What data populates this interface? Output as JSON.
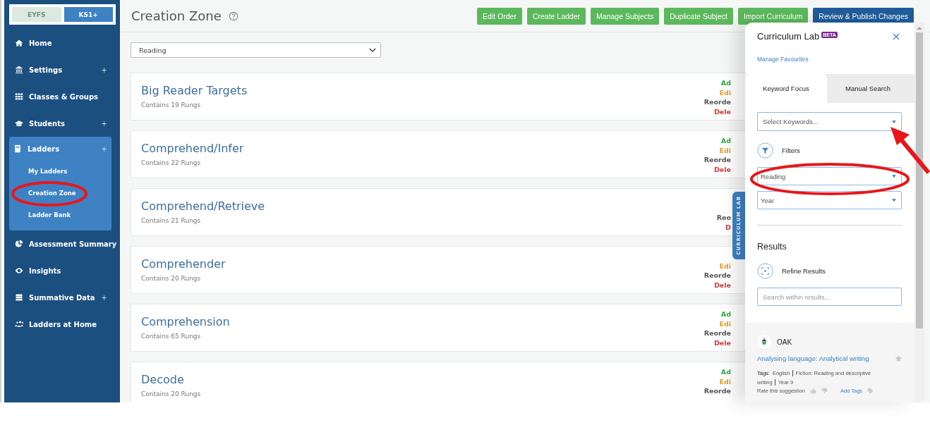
{
  "sidebar": {
    "level_toggle": [
      {
        "label": "EYFS",
        "selected": false
      },
      {
        "label": "KS1+",
        "selected": true
      }
    ],
    "items": [
      {
        "label": "Home",
        "expanded": false
      },
      {
        "label": "Settings",
        "toggle": "+",
        "expanded": false
      },
      {
        "label": "Classes & Groups",
        "expanded": false
      },
      {
        "label": "Students",
        "toggle": "+",
        "expanded": false
      },
      {
        "label": "Ladders",
        "toggle": "+",
        "expanded": true,
        "children": [
          {
            "label": "My Ladders"
          },
          {
            "label": "Creation Zone"
          },
          {
            "label": "Ladder Bank"
          }
        ]
      },
      {
        "label": "Assessment Summary",
        "expanded": false
      },
      {
        "label": "Insights",
        "expanded": false
      },
      {
        "label": "Summative Data",
        "toggle": "+",
        "expanded": false
      },
      {
        "label": "Ladders at Home",
        "expanded": false
      }
    ]
  },
  "header": {
    "title": "Creation Zone",
    "buttons": [
      {
        "label": "Edit Order",
        "kind": "success"
      },
      {
        "label": "Create Ladder",
        "kind": "success"
      },
      {
        "label": "Manage Subjects",
        "kind": "success"
      },
      {
        "label": "Duplicate Subject",
        "kind": "success"
      },
      {
        "label": "Import Curriculum",
        "kind": "success"
      },
      {
        "label": "Review & Publish Changes",
        "kind": "primary"
      }
    ]
  },
  "subject_select": {
    "value": "Reading"
  },
  "ladders": [
    {
      "title": "Big Reader Targets",
      "subtitle": "Contains 19 Rungs",
      "actions": [
        {
          "label": "Ad",
          "kind": "add"
        },
        {
          "label": "Edi",
          "kind": "edit"
        },
        {
          "label": "Reorde",
          "kind": "reorder"
        },
        {
          "label": "Dele",
          "kind": "delete"
        }
      ]
    },
    {
      "title": "Comprehend/Infer",
      "subtitle": "Contains 22 Rungs",
      "actions": [
        {
          "label": "Ad",
          "kind": "add"
        },
        {
          "label": "Edi",
          "kind": "edit"
        },
        {
          "label": "Reorde",
          "kind": "reorder"
        },
        {
          "label": "Dele",
          "kind": "delete"
        }
      ]
    },
    {
      "title": "Comprehend/Retrieve",
      "subtitle": "Contains 21 Rungs",
      "actions": [
        {
          "label": "Reo",
          "kind": "reorder"
        },
        {
          "label": "D",
          "kind": "delete"
        }
      ]
    },
    {
      "title": "Comprehender",
      "subtitle": "Contains 20 Rungs",
      "actions": [
        {
          "label": "Edi",
          "kind": "edit"
        },
        {
          "label": "Reorde",
          "kind": "reorder"
        },
        {
          "label": "Dele",
          "kind": "delete"
        }
      ]
    },
    {
      "title": "Comprehension",
      "subtitle": "Contains 65 Rungs",
      "actions": [
        {
          "label": "Ad",
          "kind": "add"
        },
        {
          "label": "Edi",
          "kind": "edit"
        },
        {
          "label": "Reorde",
          "kind": "reorder"
        },
        {
          "label": "Dele",
          "kind": "delete"
        }
      ]
    },
    {
      "title": "Decode",
      "subtitle": "Contains 20 Rungs",
      "actions": [
        {
          "label": "Ad",
          "kind": "add"
        },
        {
          "label": "Edi",
          "kind": "edit"
        },
        {
          "label": "Reorde",
          "kind": "reorder"
        }
      ]
    }
  ],
  "curriculum_tab": {
    "label": "CURRICULUM LAB"
  },
  "panel": {
    "title": "Curriculum Lab",
    "badge": "BETA",
    "link": "Manage Favourites",
    "tabs": [
      {
        "label": "Keyword Focus",
        "selected": true
      },
      {
        "label": "Manual Search",
        "selected": false
      }
    ],
    "keywords": {
      "placeholder": "Select Keywords..."
    },
    "filters_label": "Filters",
    "filters": [
      {
        "value": "Reading"
      },
      {
        "value": "Year"
      }
    ],
    "results_heading": "Results",
    "refine_label": "Refine Results",
    "search": {
      "placeholder": "Search within results..."
    },
    "result": {
      "source": "OAK",
      "title": "Analysing language: Analytical writing",
      "tags_label": "Tags:",
      "tags": [
        "English",
        "Fiction: Reading and descriptive writing",
        "Year 9"
      ],
      "rate_label": "Rate this suggestion",
      "add_tags": "Add Tags"
    }
  }
}
